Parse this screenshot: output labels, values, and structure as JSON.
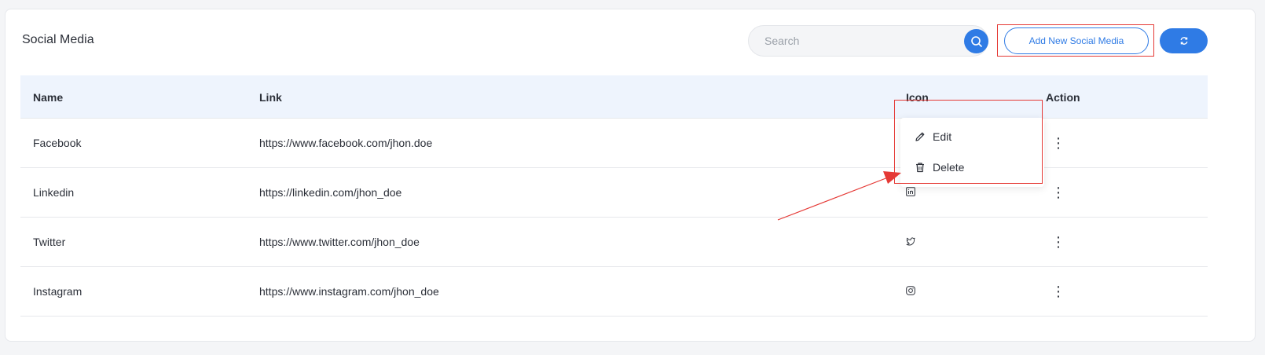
{
  "page": {
    "title": "Social Media"
  },
  "search": {
    "placeholder": "Search",
    "value": ""
  },
  "toolbar": {
    "add_label": "Add New Social Media",
    "search_icon": "search-icon",
    "refresh_icon": "refresh-icon"
  },
  "table": {
    "columns": [
      "Name",
      "Link",
      "Icon",
      "Action"
    ],
    "rows": [
      {
        "name": "Facebook",
        "link": "https://www.facebook.com/jhon.doe",
        "icon": "facebook-icon"
      },
      {
        "name": "Linkedin",
        "link": "https://linkedin.com/jhon_doe",
        "icon": "linkedin-icon"
      },
      {
        "name": "Twitter",
        "link": "https://www.twitter.com/jhon_doe",
        "icon": "twitter-icon"
      },
      {
        "name": "Instagram",
        "link": "https://www.instagram.com/jhon_doe",
        "icon": "instagram-icon"
      }
    ]
  },
  "menu": {
    "edit_label": "Edit",
    "delete_label": "Delete"
  },
  "colors": {
    "accent": "#2f7be5",
    "header_bg": "#eef4fd",
    "annotation": "#e53935"
  }
}
